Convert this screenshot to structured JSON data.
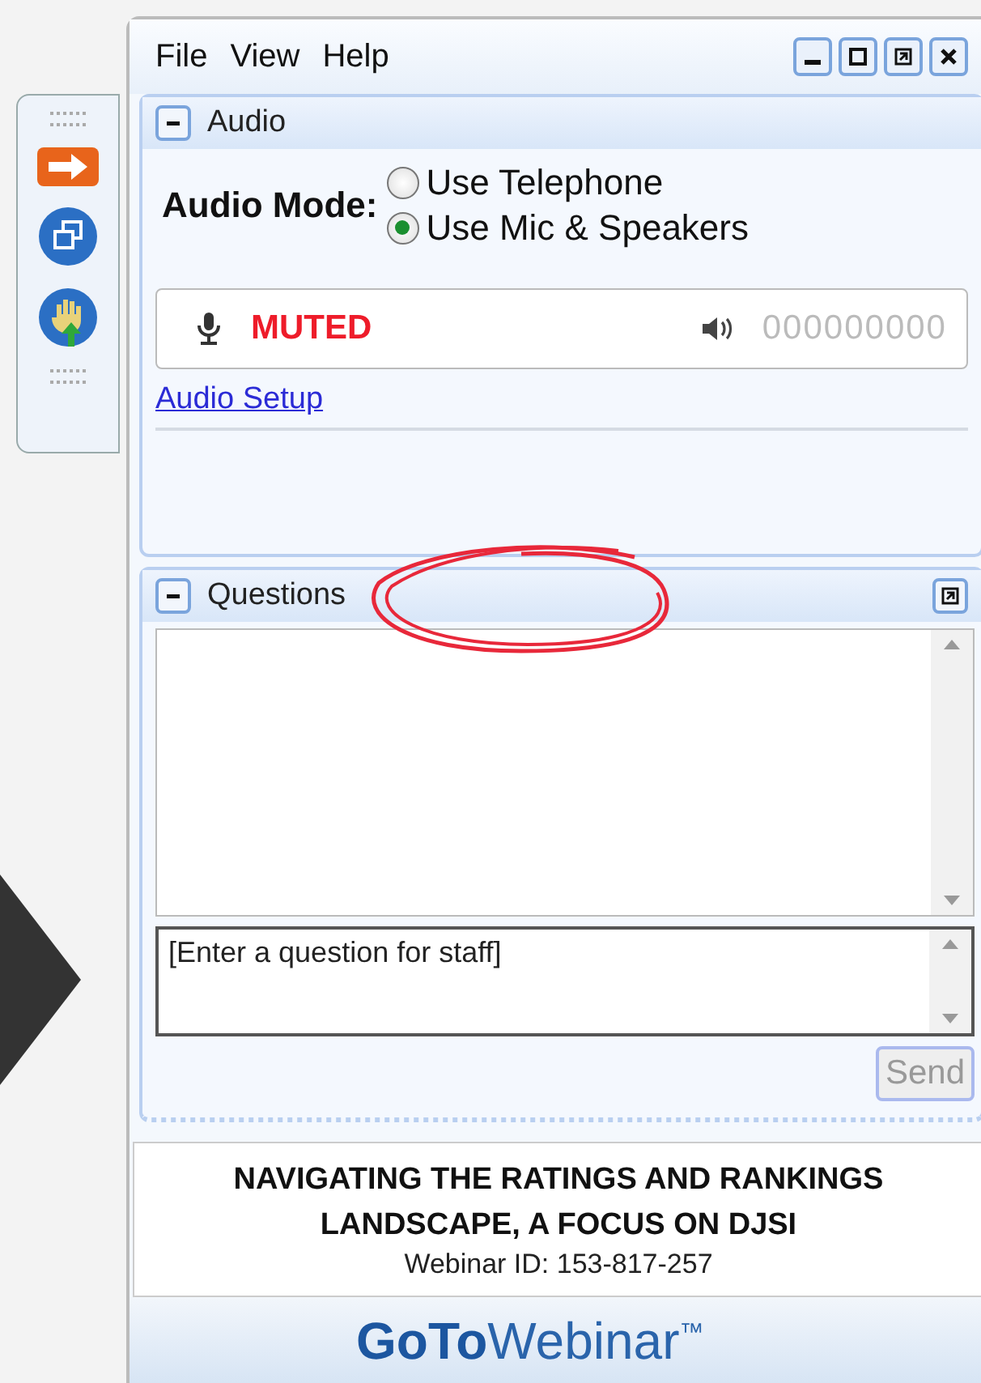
{
  "menu": [
    "File",
    "View",
    "Help"
  ],
  "audio": {
    "title": "Audio",
    "expanded": true,
    "mode_label": "Audio Mode:",
    "options": [
      {
        "label": "Use Telephone",
        "selected": false
      },
      {
        "label": "Use Mic & Speakers",
        "selected": true
      }
    ],
    "mic_status": "MUTED",
    "pin": "000000000",
    "setup_link": "Audio Setup"
  },
  "questions": {
    "title": "Questions",
    "expanded": true,
    "input": {
      "placeholder": "[Enter a question for staff]"
    },
    "send": {
      "label": "Send",
      "disabled": true
    }
  },
  "webinar": {
    "title": "NAVIGATING THE RATINGS AND RANKINGS LANDSCAPE, A FOCUS ON DJSI",
    "id": "Webinar ID: 153-817-257"
  },
  "logo": "**GoTo**Webinar$^{™}$"
}
